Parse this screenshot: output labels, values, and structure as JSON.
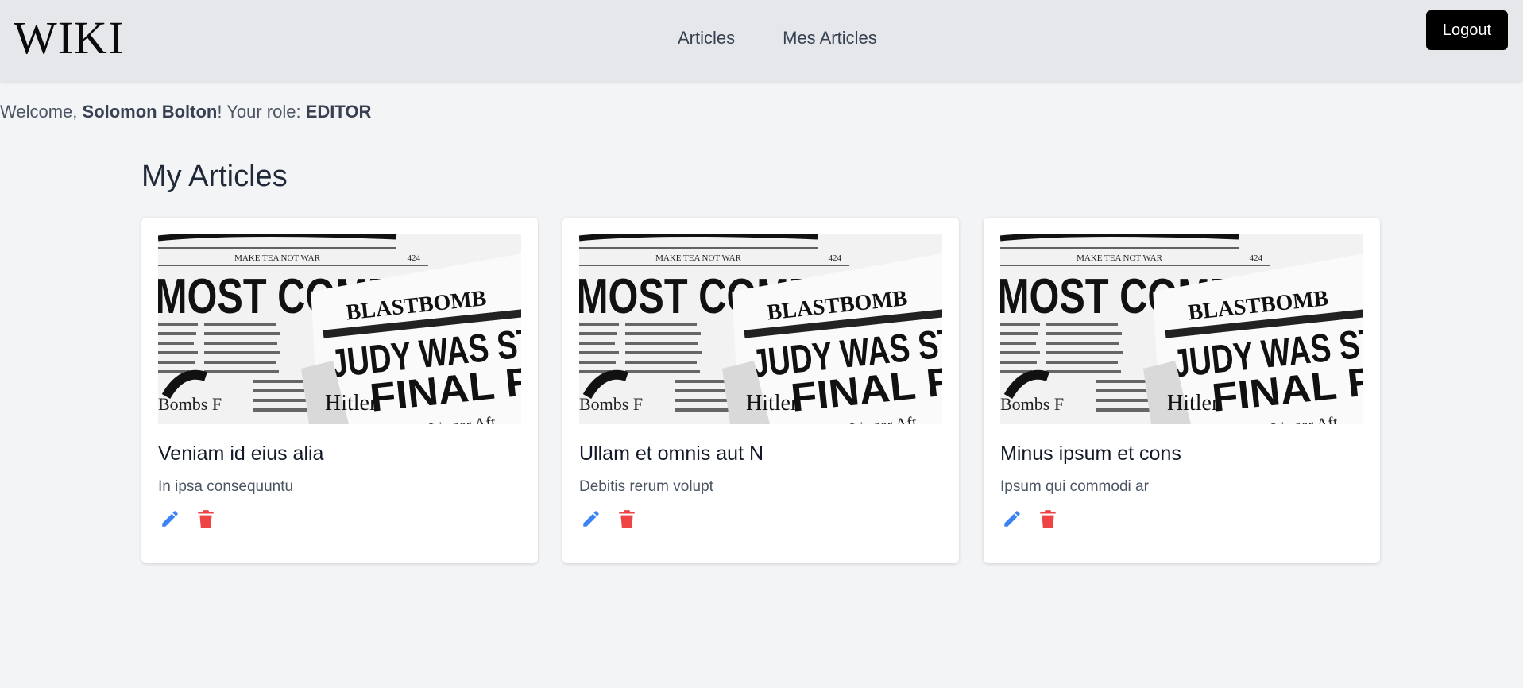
{
  "app": {
    "logo": "WIKI"
  },
  "nav": {
    "items": [
      {
        "label": "Articles"
      },
      {
        "label": "Mes Articles"
      }
    ],
    "logout_label": "Logout"
  },
  "welcome": {
    "prefix": "Welcome, ",
    "user": "Solomon Bolton",
    "middle": "! Your role: ",
    "role": "EDITOR"
  },
  "page": {
    "title": "My Articles"
  },
  "articles": [
    {
      "title": "Veniam id eius alia",
      "excerpt": "In ipsa consequuntu",
      "image_text": {
        "masthead": "MAKE TEA NOT WAR",
        "number": "424",
        "headline1": "MOST COMPL",
        "paper": "BLASTBOMB",
        "headline2": "JUDY WAS ST",
        "headline3": "FINAL R",
        "word1": "Hitler",
        "word2": "Linger Aft",
        "word3": "Bombs F"
      }
    },
    {
      "title": "Ullam et omnis aut N",
      "excerpt": "Debitis rerum volupt",
      "image_text": {
        "masthead": "MAKE TEA NOT WAR",
        "number": "424",
        "headline1": "MOST COMPL",
        "paper": "BLASTBOMB",
        "headline2": "JUDY WAS ST",
        "headline3": "FINAL R",
        "word1": "Hitler",
        "word2": "Linger Aft",
        "word3": "Bombs F"
      }
    },
    {
      "title": "Minus ipsum et cons",
      "excerpt": "Ipsum qui commodi ar",
      "image_text": {
        "masthead": "MAKE TEA NOT WAR",
        "number": "424",
        "headline1": "MOST COMPL",
        "paper": "BLASTBOMB",
        "headline2": "JUDY WAS ST",
        "headline3": "FINAL R",
        "word1": "Hitler",
        "word2": "Linger Aft",
        "word3": "Bombs F"
      }
    }
  ],
  "icons": {
    "edit": "pencil-icon",
    "delete": "trash-icon"
  },
  "colors": {
    "edit_icon": "#3b82f6",
    "delete_icon": "#ef4444",
    "logout_bg": "#000000",
    "navbar_bg": "#e5e7eb",
    "page_bg": "#f3f4f6"
  }
}
